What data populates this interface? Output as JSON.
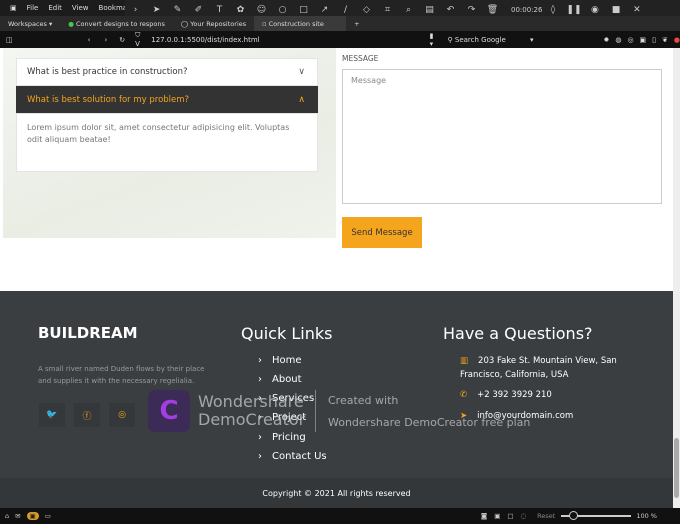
{
  "menu": [
    "File",
    "Edit",
    "View",
    "Bookmarks"
  ],
  "recorder": {
    "timer": "00:00:26"
  },
  "tabs": [
    {
      "label": "Workspaces"
    },
    {
      "label": "Convert designs to respons"
    },
    {
      "label": "Your Repositories"
    },
    {
      "label": "Construction site"
    }
  ],
  "address": {
    "url": "127.0.0.1:5500/dist/index.html",
    "search_placeholder": "Search Google"
  },
  "faq": [
    {
      "question": "What is best practice in construction?"
    },
    {
      "question": "What is best solution for my problem?",
      "answer": "Lorem ipsum dolor sit, amet consectetur adipisicing elit. Voluptas odit aliquam beatae!"
    }
  ],
  "form": {
    "message_label": "MESSAGE",
    "message_placeholder": "Message",
    "send_label": "Send Message"
  },
  "footer": {
    "brand": "BUILDREAM",
    "about": "A small river named Duden flows by their place and supplies it with the necessary regelialia.",
    "quick_links_title": "Quick Links",
    "links": [
      "Home",
      "About",
      "Services",
      "Project",
      "Pricing",
      "Contact Us"
    ],
    "contact_title": "Have a Questions?",
    "address": "203 Fake St. Mountain View, San Francisco, California, USA",
    "phone": "+2 392 3929 210",
    "email": "info@yourdomain.com",
    "copyright": "Copyright © 2021 All rights reserved"
  },
  "watermark": {
    "brand": "Wondershare DemoCreator",
    "line1": "Created with",
    "line2": "Wondershare DemoCreator free plan"
  },
  "status": {
    "zoom": "100 %",
    "reset": "Reset"
  },
  "colors": {
    "accent": "#f5a41e",
    "footer": "#3b3e41",
    "faq_active": "#333333"
  }
}
